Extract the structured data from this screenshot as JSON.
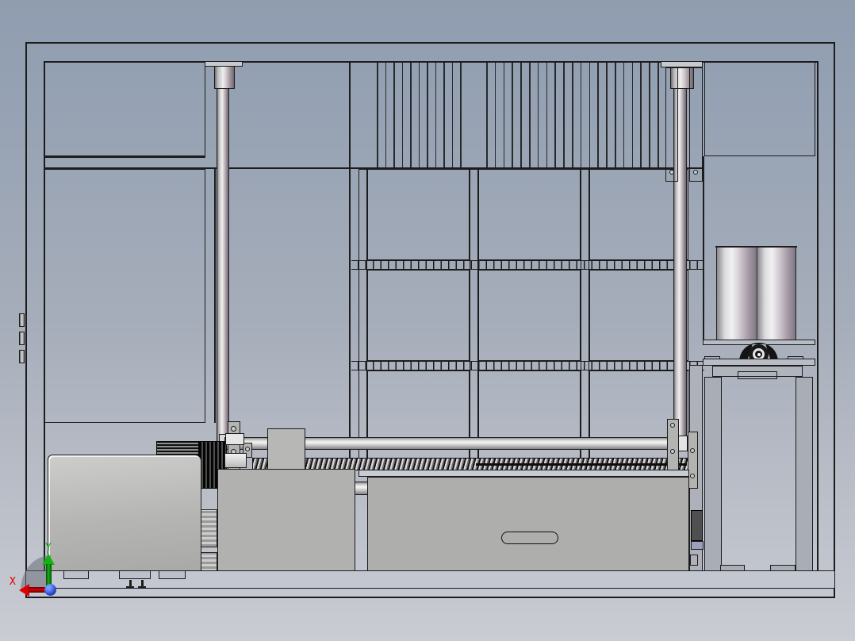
{
  "app": {
    "type": "cad-3d-viewport",
    "visible_text": [
      "X",
      "Y"
    ]
  },
  "viewport": {
    "background_top": "#8f9db0",
    "background_bottom": "#c9ccd3",
    "edge_color": "#1c1c1c",
    "face_color": "#a6adba",
    "box_color": "#aeaeac",
    "base_color": "#c3c7d0",
    "pad_color": "#9aa0bb"
  },
  "orientation_triad": {
    "x_label": "X",
    "y_label": "Y",
    "x_axis_color": "#dd0000",
    "y_axis_color": "#12b212",
    "origin_color": "#2f55d4"
  },
  "model": {
    "components": [
      "machine-outer-frame",
      "left-door-panels",
      "vertical-slat-grill",
      "center-panel-grid",
      "toothed-cross-rails",
      "left-guide-post",
      "right-guide-post",
      "right-upper-panel",
      "twin-tank-rollers",
      "pillow-block-bearing",
      "right-support-columns",
      "drive-shaft",
      "lead-screw",
      "carriage-block",
      "stepper-motor-heatsink",
      "gearbox-housing",
      "linear-slide-rail",
      "mid-slide-box",
      "long-cover-box-with-slot",
      "base-plate",
      "levelling-feet",
      "door-hinges",
      "xyz-origin-triad"
    ]
  }
}
